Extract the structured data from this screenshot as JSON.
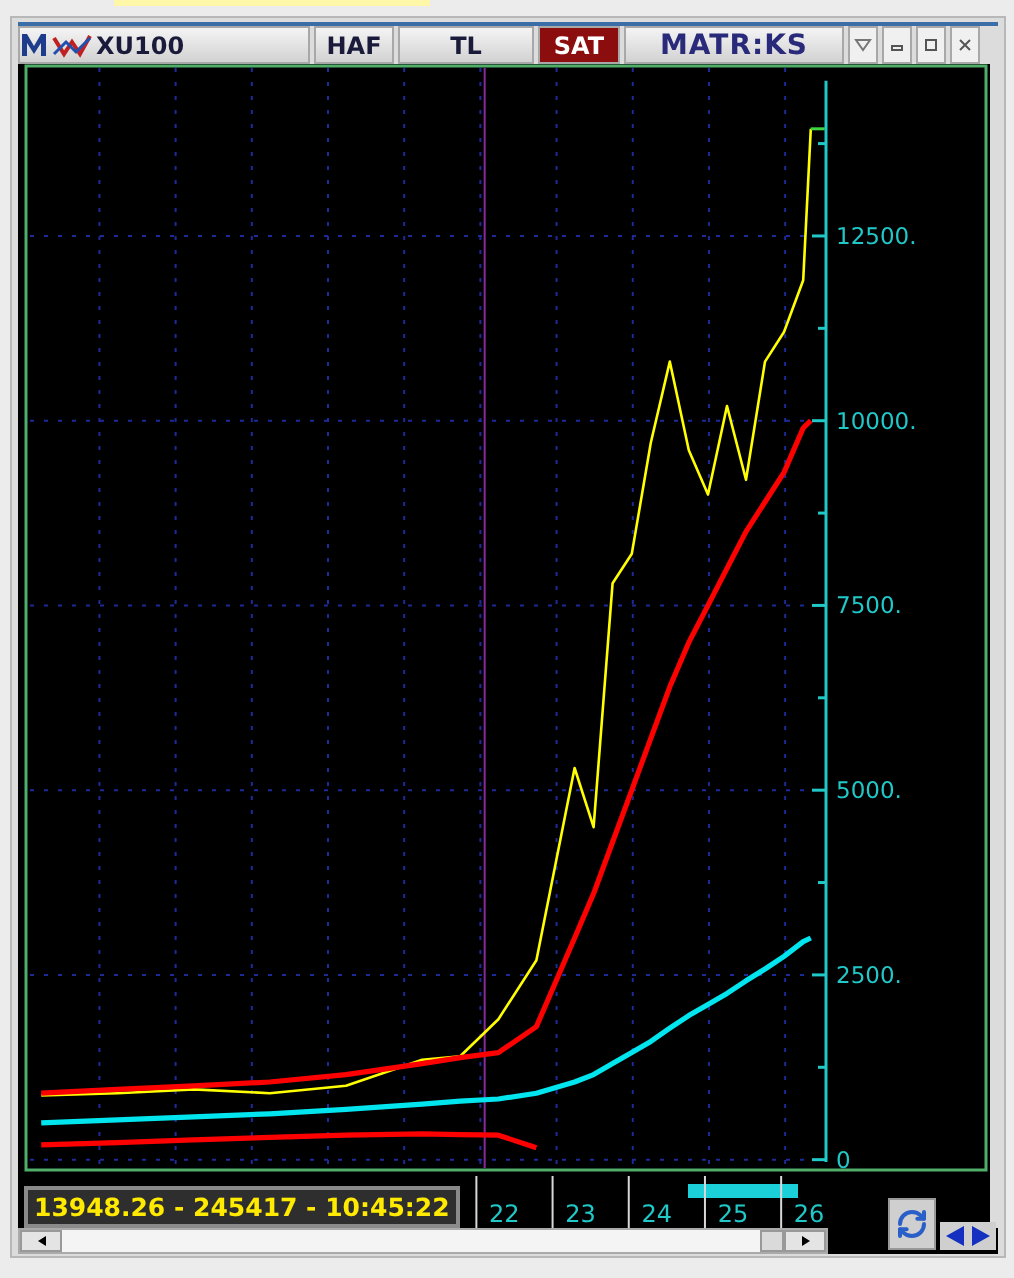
{
  "toolbar": {
    "symbol": "XU100",
    "buttons": [
      {
        "label": "HAF",
        "selected": false
      },
      {
        "label": "TL",
        "selected": false
      },
      {
        "label": "SAT",
        "selected": true
      }
    ],
    "brand": "MATR:KS"
  },
  "chart": {
    "chart_data": {
      "type": "line",
      "x": [
        16,
        17,
        18,
        19,
        20,
        21,
        21.5,
        22,
        22.5,
        23,
        23.25,
        23.5,
        23.75,
        24,
        24.25,
        24.5,
        24.75,
        25,
        25.25,
        25.5,
        25.75,
        26,
        26.1
      ],
      "series": [
        {
          "color": "#ffff00",
          "values": [
            870,
            900,
            950,
            900,
            1000,
            1350,
            1400,
            1900,
            2700,
            5300,
            4500,
            7800,
            8200,
            9700,
            10800,
            9600,
            9000,
            10200,
            9200,
            10800,
            11200,
            11900,
            13950
          ]
        },
        {
          "color": "#ff0000",
          "values": [
            900,
            950,
            1000,
            1050,
            1150,
            1300,
            1380,
            1450,
            1800,
            3000,
            3600,
            4300,
            5000,
            5700,
            6400,
            7000,
            7500,
            8000,
            8500,
            8900,
            9300,
            9900,
            10000
          ]
        },
        {
          "color": "#00e5ee",
          "values": [
            500,
            540,
            580,
            620,
            680,
            750,
            790,
            820,
            900,
            1050,
            1150,
            1300,
            1450,
            1600,
            1780,
            1950,
            2100,
            2250,
            2420,
            2580,
            2750,
            2950,
            3000
          ]
        },
        {
          "color": "#ff0000",
          "values": [
            200,
            230,
            270,
            300,
            330,
            350,
            340,
            330,
            160,
            null,
            null,
            null,
            null,
            null,
            null,
            null,
            null,
            null,
            null,
            null,
            null,
            null,
            null
          ]
        }
      ],
      "xlim": [
        15.8,
        28.4
      ],
      "ylim": [
        -140,
        14800
      ],
      "grid": true,
      "ref_lines": [
        {
          "axis": "x",
          "value": 21.82,
          "color": "#8a2a9a"
        }
      ],
      "xticks": [
        22,
        23,
        24,
        25,
        26
      ],
      "yticks": [
        {
          "value": 0,
          "label": "0"
        },
        {
          "value": 2500,
          "label": "2500."
        },
        {
          "value": 5000,
          "label": "5000."
        },
        {
          "value": 7500,
          "label": "7500."
        },
        {
          "value": 10000,
          "label": "10000."
        },
        {
          "value": 12500,
          "label": "12500."
        }
      ]
    },
    "readout": "13948.26 - 245417 - 10:45:22"
  }
}
